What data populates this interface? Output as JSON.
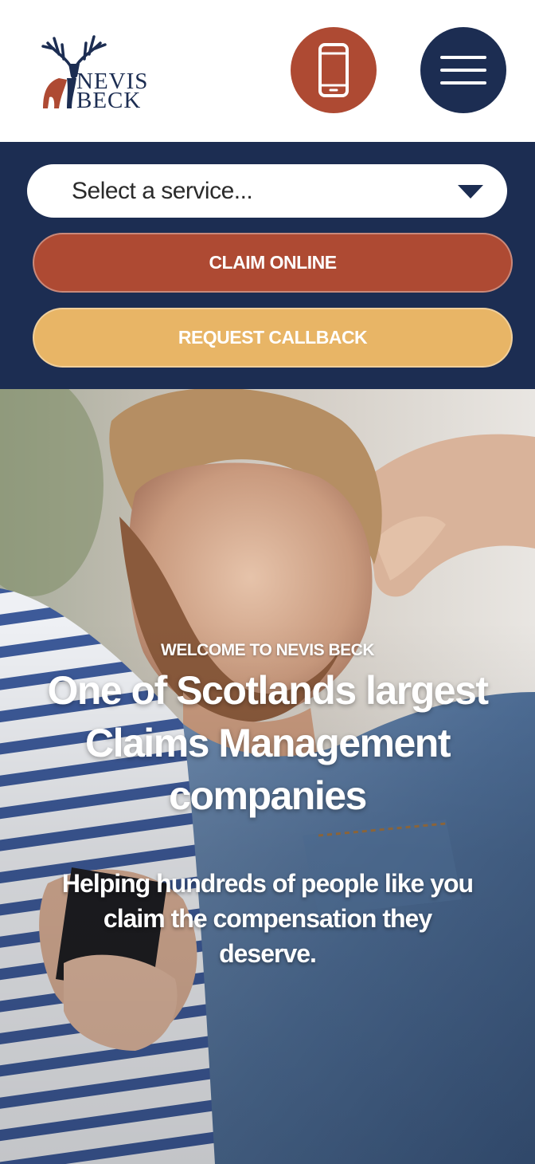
{
  "brand": {
    "name_line1": "NEVIS",
    "name_line2": "BECK",
    "colors": {
      "navy": "#1c2d52",
      "rust": "#ae4a33",
      "gold": "#e8b566"
    }
  },
  "header": {
    "phone_icon": "phone-icon",
    "menu_icon": "hamburger-menu-icon"
  },
  "actions": {
    "service_select": {
      "value": "Select a service..."
    },
    "claim_online": "CLAIM ONLINE",
    "request_callback": "REQUEST CALLBACK"
  },
  "hero": {
    "eyebrow": "WELCOME TO NEVIS BECK",
    "headline_line1": "One of Scotlands largest",
    "headline_line2": "Claims Management",
    "headline_line3": "companies",
    "sub_line1": "Helping hundreds of people like you",
    "sub_line2": "claim the compensation they",
    "sub_line3": "deserve."
  }
}
